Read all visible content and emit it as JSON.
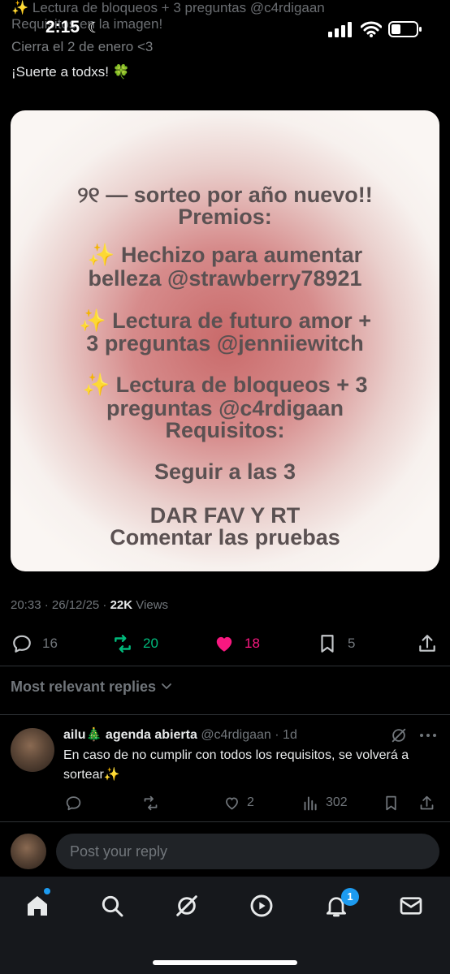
{
  "status_bar": {
    "time": "2:15"
  },
  "tweet": {
    "text_lines": [
      "✨ Lectura de bloqueos + 3 preguntas @c4rdigaan",
      "Requisitos en la imagen!",
      "Cierra el 2 de enero <3",
      "¡Suerte a todxs! 🍀"
    ],
    "image_text": {
      "title_line1": "୨୧ — sorteo por año nuevo!!",
      "title_line2": "Premios:",
      "prize1_line1": "Hechizo para aumentar",
      "prize1_line2": "belleza @strawberry78921",
      "prize2_line1": "Lectura de futuro amor +",
      "prize2_line2": "3 preguntas @jenniiewitch",
      "prize3_line1": "Lectura de bloqueos + 3",
      "prize3_line2": "preguntas @c4rdigaan",
      "requisitos": "Requisitos:",
      "req1": "Seguir a las 3",
      "req2": "DAR FAV Y RT",
      "req3": "Comentar las pruebas",
      "sparkle": "✨"
    },
    "timestamp": "20:33 · 26/12/25 · ",
    "views_count": "22K",
    "views_label": " Views",
    "actions": {
      "replies": "16",
      "retweets": "20",
      "likes": "18",
      "bookmarks": "5"
    }
  },
  "replies_header": "Most relevant replies",
  "reply": {
    "name": "ailu🎄 agenda abierta",
    "handle": "@c4rdigaan · 1d",
    "text": "En caso de no cumplir con todos los requisitos, se volverá a sortear✨",
    "retweets": "",
    "likes": "2",
    "views": "302"
  },
  "reply_box": {
    "placeholder": "Post your reply"
  },
  "nav": {
    "notifications_badge": "1"
  },
  "colors": {
    "accent": "#1d9bf0",
    "retweet": "#00ba7c",
    "like": "#f91880"
  }
}
